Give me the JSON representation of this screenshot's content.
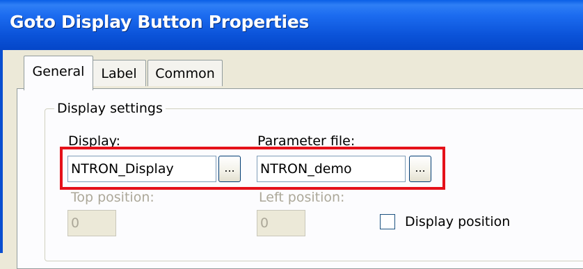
{
  "window": {
    "title": "Goto Display Button Properties"
  },
  "tabs": [
    {
      "label": "General"
    },
    {
      "label": "Label"
    },
    {
      "label": "Common"
    }
  ],
  "display_settings": {
    "group_label": "Display settings",
    "display_label": "Display:",
    "display_value": "NTRON_Display",
    "display_browse_label": "...",
    "parameter_label": "Parameter file:",
    "parameter_value": "NTRON_demo",
    "parameter_browse_label": "...",
    "top_position_label": "Top position:",
    "top_position_value": "0",
    "left_position_label": "Left position:",
    "left_position_value": "0",
    "display_position_label": "Display position",
    "display_position_checked": false
  },
  "colors": {
    "title_bar": "#0A5FE6",
    "highlight_box": "#E5111A",
    "dialog_background": "#ECE9D8"
  }
}
